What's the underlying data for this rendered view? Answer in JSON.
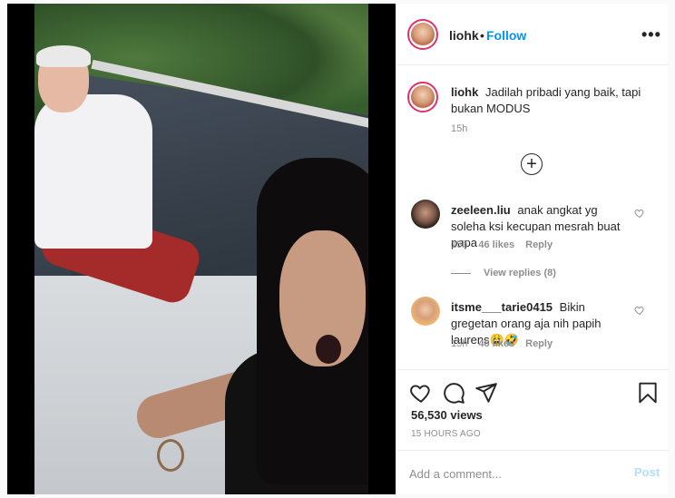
{
  "header": {
    "username": "liohk",
    "separator": "•",
    "follow_label": "Follow",
    "more_icon": "more-horizontal-icon",
    "more_label": "•••"
  },
  "caption": {
    "username": "liohk",
    "text": "Jadilah pribadi yang baik, tapi bukan MODUS",
    "time": "15h"
  },
  "load_more": {
    "icon": "plus-circle-icon",
    "label": "+"
  },
  "comments": [
    {
      "username": "zeeleen.liu",
      "text": "anak angkat yg soleha ksi kecupan mesrah buat papa",
      "time": "15h",
      "likes": "46 likes",
      "reply_label": "Reply",
      "view_replies": "View replies (8)"
    },
    {
      "username": "itsme___tarie0415",
      "text": "Bikin gregetan orang aja nih papih laurens😩🤣",
      "time": "15h",
      "likes": "48 likes",
      "reply_label": "Reply"
    }
  ],
  "actions": {
    "like_icon": "heart-icon",
    "comment_icon": "comment-icon",
    "share_icon": "share-icon",
    "save_icon": "bookmark-icon"
  },
  "stats": {
    "views": "56,530 views",
    "posted_ago": "15 HOURS AGO"
  },
  "comment_box": {
    "placeholder": "Add a comment...",
    "post_label": "Post"
  },
  "colors": {
    "link_blue": "#0095f6",
    "post_disabled": "#b2dffc",
    "muted_text": "#8e8e8e",
    "story_ring": "#e1306c"
  }
}
